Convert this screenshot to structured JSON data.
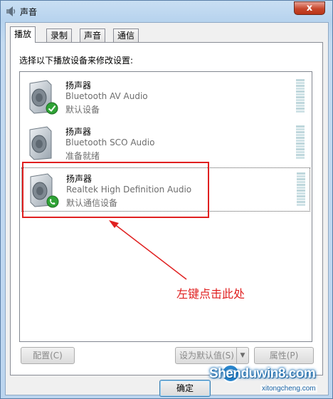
{
  "window": {
    "title": "声音",
    "close_label": "x"
  },
  "tabs": [
    {
      "label": "播放",
      "active": true
    },
    {
      "label": "录制",
      "active": false
    },
    {
      "label": "声音",
      "active": false
    },
    {
      "label": "通信",
      "active": false
    }
  ],
  "instruction": "选择以下播放设备来修改设置:",
  "devices": [
    {
      "name": "扬声器",
      "description": "Bluetooth AV Audio",
      "status": "默认设备",
      "badge": "check-badge-icon"
    },
    {
      "name": "扬声器",
      "description": "Bluetooth SCO Audio",
      "status": "准备就绪",
      "badge": ""
    },
    {
      "name": "扬声器",
      "description": "Realtek High Definition Audio",
      "status": "默认通信设备",
      "badge": "phone-badge-icon",
      "selected": true
    }
  ],
  "buttons": {
    "configure": "配置(C)",
    "set_default": "设为默认值(S)",
    "properties": "属性(P)",
    "ok": "确定"
  },
  "annotation": {
    "text": "左键点击此处",
    "color": "#e02020"
  },
  "watermark": {
    "main": "Shenduwin8.com",
    "sub": "xitongcheng.com"
  }
}
